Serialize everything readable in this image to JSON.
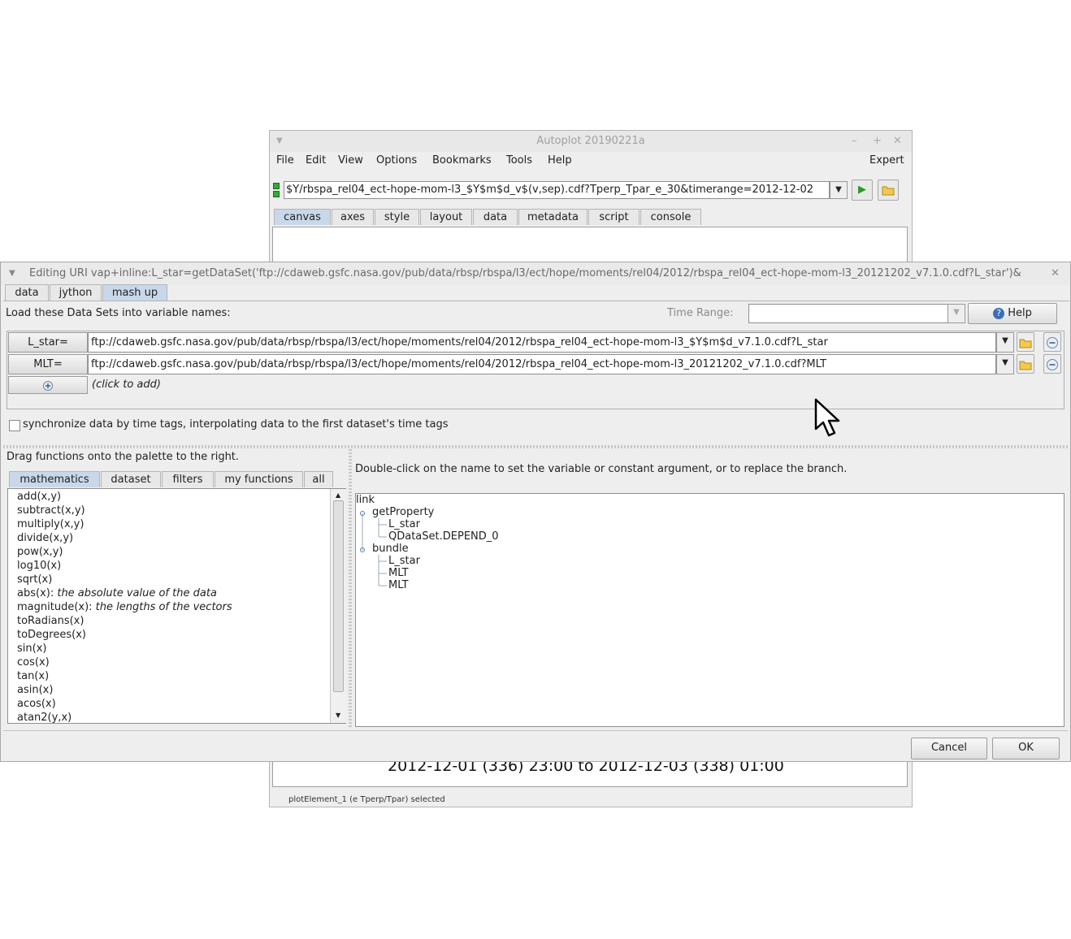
{
  "main_window": {
    "title": "Autoplot 20190221a",
    "controls": [
      "–",
      "+",
      "✕"
    ],
    "menu": [
      "File",
      "Edit",
      "View",
      "Options",
      "Bookmarks",
      "Tools",
      "Help"
    ],
    "expert_label": "Expert",
    "uri_value": "$Y/rbspa_rel04_ect-hope-mom-l3_$Y$m$d_v$(v,sep).cdf?Tperp_Tpar_e_30&timerange=2012-12-02",
    "tabs": [
      "canvas",
      "axes",
      "style",
      "layout",
      "data",
      "metadata",
      "script",
      "console"
    ],
    "selected_tab": "canvas",
    "timerange_text": "2012-12-01 (336) 23:00 to 2012-12-03 (338) 01:00",
    "status_text": "plotElement_1 (e Tperp/Tpar) selected"
  },
  "dialog": {
    "title": "Editing URI vap+inline:L_star=getDataSet('ftp://cdaweb.gsfc.nasa.gov/pub/data/rbsp/rbspa/l3/ect/hope/moments/rel04/2012/rbspa_rel04_ect-hope-mom-l3_20121202_v7.1.0.cdf?L_star')&",
    "tabs": [
      "data",
      "jython",
      "mash up"
    ],
    "selected_tab": "mash up",
    "load_label": "Load these Data Sets into variable names:",
    "time_range_label": "Time Range:",
    "time_range_value": "",
    "help_label": "Help",
    "variables": [
      {
        "name": "L_star=",
        "uri": "ftp://cdaweb.gsfc.nasa.gov/pub/data/rbsp/rbspa/l3/ect/hope/moments/rel04/2012/rbspa_rel04_ect-hope-mom-l3_$Y$m$d_v7.1.0.cdf?L_star"
      },
      {
        "name": "MLT=",
        "uri": "ftp://cdaweb.gsfc.nasa.gov/pub/data/rbsp/rbspa/l3/ect/hope/moments/rel04/2012/rbspa_rel04_ect-hope-mom-l3_20121202_v7.1.0.cdf?MLT"
      }
    ],
    "add_hint": "(click to add)",
    "sync_label": "synchronize data by time tags, interpolating data to the first dataset's time tags",
    "sync_checked": false,
    "palette_label": "Drag functions onto the palette to the right.",
    "function_tabs": [
      "mathematics",
      "dataset",
      "filters",
      "my functions",
      "all"
    ],
    "selected_function_tab": "mathematics",
    "functions": [
      {
        "name": "add(x,y)",
        "desc": ""
      },
      {
        "name": "subtract(x,y)",
        "desc": ""
      },
      {
        "name": "multiply(x,y)",
        "desc": ""
      },
      {
        "name": "divide(x,y)",
        "desc": ""
      },
      {
        "name": "pow(x,y)",
        "desc": ""
      },
      {
        "name": "log10(x)",
        "desc": ""
      },
      {
        "name": "sqrt(x)",
        "desc": ""
      },
      {
        "name": "abs(x): ",
        "desc": "the absolute value of the data"
      },
      {
        "name": "magnitude(x): ",
        "desc": "the lengths of the vectors"
      },
      {
        "name": "toRadians(x)",
        "desc": ""
      },
      {
        "name": "toDegrees(x)",
        "desc": ""
      },
      {
        "name": "sin(x)",
        "desc": ""
      },
      {
        "name": "cos(x)",
        "desc": ""
      },
      {
        "name": "tan(x)",
        "desc": ""
      },
      {
        "name": "asin(x)",
        "desc": ""
      },
      {
        "name": "acos(x)",
        "desc": ""
      },
      {
        "name": "atan2(y,x)",
        "desc": ""
      }
    ],
    "tree_instructions": "Double-click on the name to set the variable or constant argument, or to replace the branch.",
    "tree": {
      "root": "link",
      "nodes": [
        {
          "label": "getProperty",
          "children": [
            "L_star",
            "QDataSet.DEPEND_0"
          ]
        },
        {
          "label": "bundle",
          "children": [
            "L_star",
            "MLT",
            "MLT"
          ]
        }
      ]
    },
    "cancel_label": "Cancel",
    "ok_label": "OK"
  }
}
